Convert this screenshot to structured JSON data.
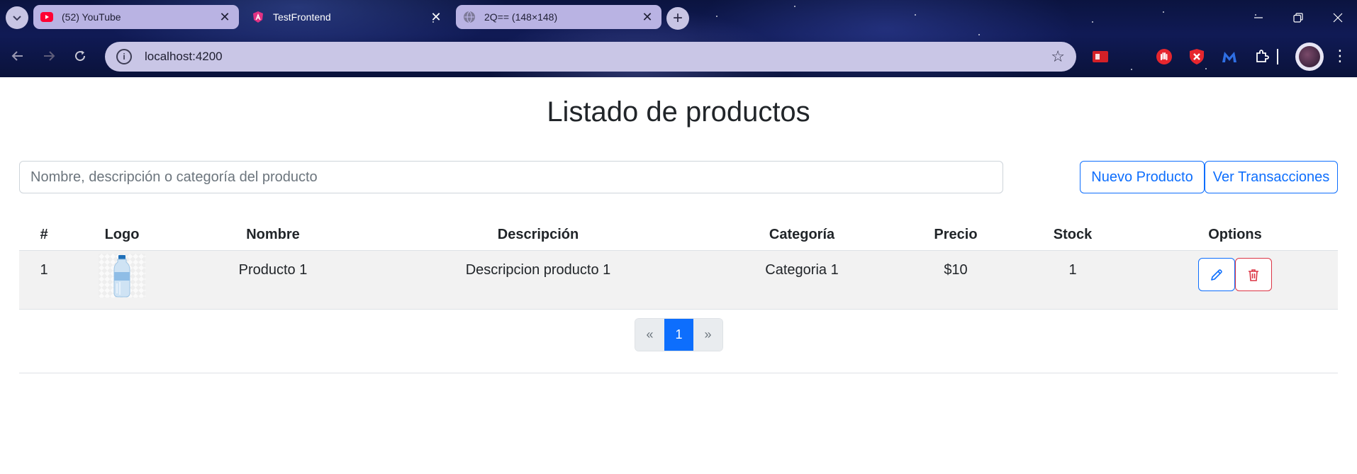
{
  "browser": {
    "tabs": [
      {
        "title": "(52) YouTube",
        "state": "inactive"
      },
      {
        "title": "TestFrontend",
        "state": "active"
      },
      {
        "title": "2Q== (148×148)",
        "state": "inactive"
      }
    ],
    "address_bar": {
      "url": "localhost:4200"
    }
  },
  "page": {
    "title": "Listado de productos",
    "search": {
      "placeholder": "Nombre, descripción o categoría del producto",
      "value": ""
    },
    "buttons": {
      "new_product": "Nuevo Producto",
      "view_transactions": "Ver Transacciones"
    }
  },
  "table": {
    "headers": [
      "#",
      "Logo",
      "Nombre",
      "Descripción",
      "Categoría",
      "Precio",
      "Stock",
      "Options"
    ],
    "rows": [
      {
        "index": "1",
        "logo": "water-bottle-image",
        "name": "Producto 1",
        "description": "Descripcion producto 1",
        "category": "Categoria 1",
        "price": "$10",
        "stock": "1"
      }
    ]
  },
  "pagination": {
    "prev": "«",
    "current": "1",
    "next": "»"
  },
  "colors": {
    "primary": "#0d6efd",
    "danger": "#dc3545",
    "row_bg": "#f2f2f2"
  }
}
